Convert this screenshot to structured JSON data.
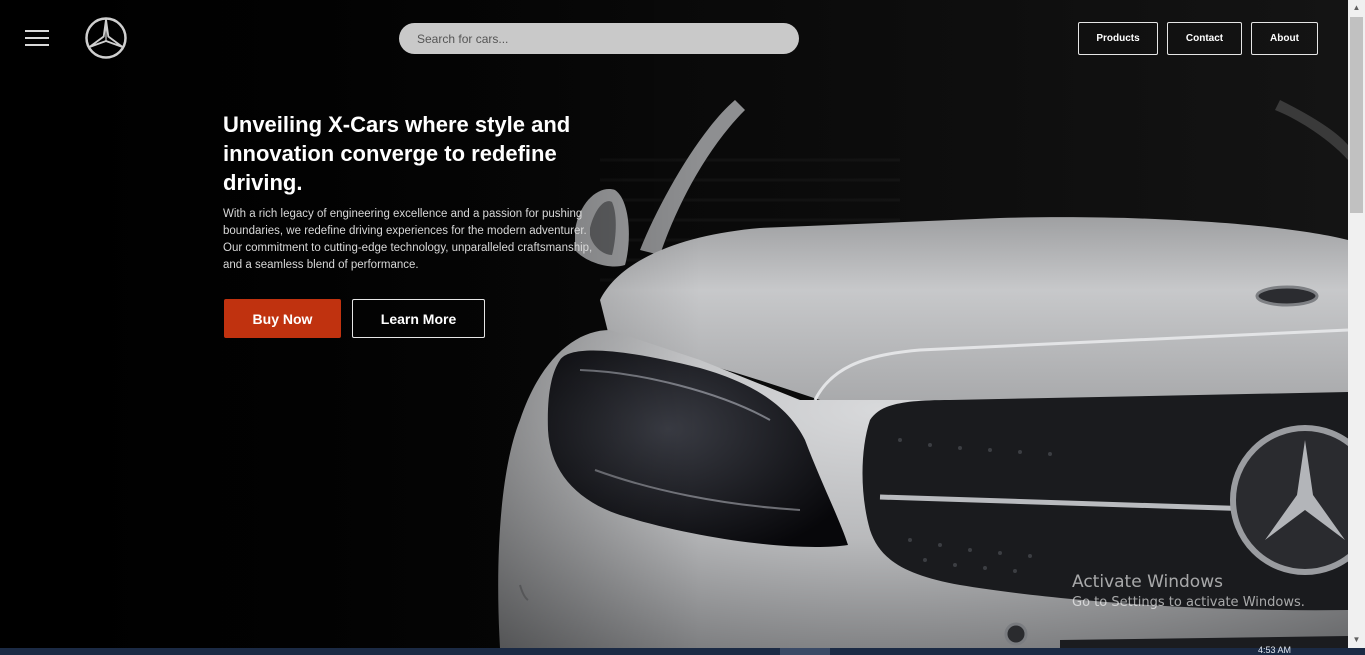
{
  "nav": {
    "search_placeholder": "Search for cars...",
    "products_label": "Products",
    "contact_label": "Contact",
    "about_label": "About"
  },
  "hero": {
    "headline": "Unveiling X-Cars where style and innovation converge to redefine driving.",
    "description": "With a rich legacy of engineering excellence and a passion for pushing boundaries, we redefine driving experiences for the modern adventurer. Our commitment to cutting-edge technology, unparalleled craftsmanship, and a seamless blend of performance.",
    "buy_label": "Buy Now",
    "learn_label": "Learn More",
    "accent_color": "#c0320f"
  },
  "watermark": {
    "line1": "Activate Windows",
    "line2": "Go to Settings to activate Windows."
  },
  "taskbar": {
    "time": "4:53 AM"
  },
  "icons": [
    "menu-icon",
    "mercedes-logo-icon",
    "scroll-up-icon",
    "scroll-down-icon"
  ]
}
